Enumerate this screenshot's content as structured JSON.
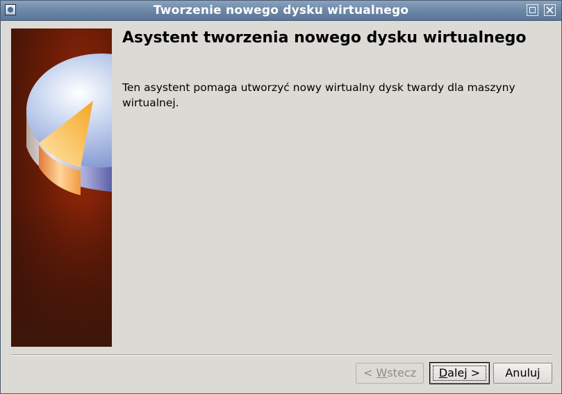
{
  "window": {
    "title": "Tworzenie nowego dysku wirtualnego",
    "icon": "virtualbox-app-icon"
  },
  "titlebar_buttons": {
    "maximize_icon": "maximize-icon",
    "close_icon": "close-icon"
  },
  "page": {
    "heading": "Asystent tworzenia nowego dysku wirtualnego",
    "description": "Ten asystent pomaga utworzyć nowy wirtualny dysk twardy dla maszyny wirtualnej."
  },
  "buttons": {
    "back": {
      "prefix": "< ",
      "mnemonic": "W",
      "rest": "stecz",
      "enabled": false
    },
    "next": {
      "mnemonic": "D",
      "rest": "alej >",
      "enabled": true,
      "focused": true
    },
    "cancel": {
      "label": "Anuluj",
      "enabled": true
    }
  },
  "colors": {
    "titlebar": "#6f89a8",
    "window_bg": "#dcdad5",
    "side_image_bg": "#5a1a08",
    "disk_top": "#d8e2f4",
    "disk_slice": "#f5a623"
  }
}
